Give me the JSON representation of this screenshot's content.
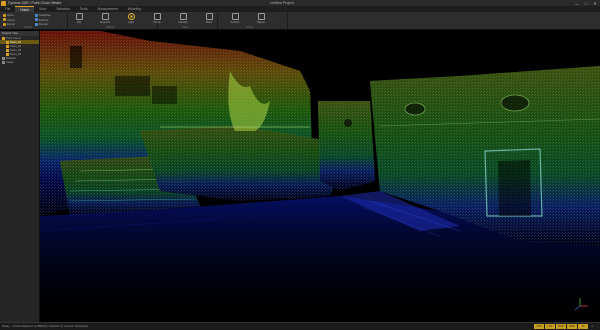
{
  "window": {
    "app_name": "Cyclone 3DR / Point Cloud Viewer",
    "title": "Untitled Project",
    "controls": [
      "—",
      "□",
      "✕"
    ]
  },
  "tabs": [
    {
      "label": "File",
      "active": false
    },
    {
      "label": "Home",
      "active": true
    },
    {
      "label": "View",
      "active": false
    },
    {
      "label": "Selection",
      "active": false
    },
    {
      "label": "Tools",
      "active": false
    },
    {
      "label": "Measurement",
      "active": false
    },
    {
      "label": "Modeling",
      "active": false
    }
  ],
  "ribbon": {
    "small_buttons": [
      {
        "label": "Open",
        "color": "#d8a020"
      },
      {
        "label": "Import",
        "color": "#d8a020"
      },
      {
        "label": "Export",
        "color": "#d8a020"
      },
      {
        "label": "Snapshot",
        "color": "#4a90d0"
      },
      {
        "label": "Explore",
        "color": "#4a90d0"
      },
      {
        "label": "Render",
        "color": "#4a90d0"
      }
    ],
    "big_buttons": [
      {
        "label": "Clip",
        "icon": "box-icon"
      },
      {
        "label": "Segment",
        "icon": "box-icon"
      },
      {
        "label": "Light",
        "icon": "sun-icon"
      },
      {
        "label": "Points",
        "icon": "box-icon"
      },
      {
        "label": "Classify",
        "icon": "box-icon"
      },
      {
        "label": "Mesh",
        "icon": "box-icon"
      },
      {
        "label": "Section",
        "icon": "box-icon"
      },
      {
        "label": "Report",
        "icon": "box-icon"
      }
    ],
    "group_names": [
      "Project",
      "Display",
      "Tools",
      "Output"
    ]
  },
  "panel": {
    "title": "Project Tree",
    "items": [
      {
        "label": "Point Cloud",
        "color": "#d8a020",
        "selected": false,
        "indent": 0
      },
      {
        "label": "Scan_01",
        "color": "#d8a020",
        "selected": true,
        "indent": 1
      },
      {
        "label": "Scan_02",
        "color": "#d8a020",
        "selected": false,
        "indent": 1
      },
      {
        "label": "Scan_03",
        "color": "#d8a020",
        "selected": false,
        "indent": 1
      },
      {
        "label": "Scan_04",
        "color": "#d8a020",
        "selected": false,
        "indent": 1
      },
      {
        "label": "Meshes",
        "color": "#888888",
        "selected": false,
        "indent": 0
      },
      {
        "label": "Views",
        "color": "#888888",
        "selected": false,
        "indent": 0
      }
    ]
  },
  "status": {
    "text": "Ready — Points displayed: 12,458,091 | Selected: 0 | Camera: Perspective",
    "buttons": [
      "FPS",
      "LOD",
      "SNAP",
      "GRID",
      "3D"
    ],
    "axis_icon": "axes-icon"
  },
  "colors": {
    "accent": "#d8a020",
    "height_low": "#0000ff",
    "height_mid": "#00cc00",
    "height_high": "#ff0000"
  }
}
